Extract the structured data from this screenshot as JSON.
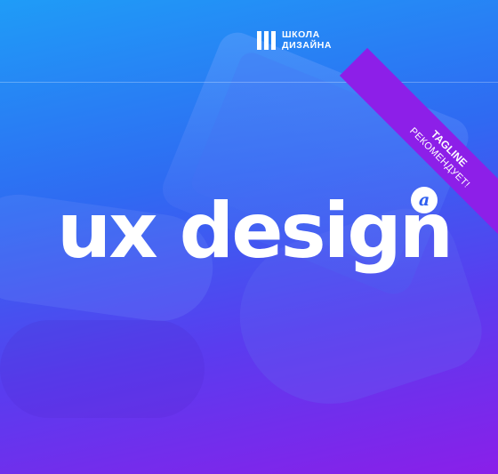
{
  "brand": {
    "line1": "ШКОЛА",
    "line2": "ДИЗАЙНА",
    "mark_icon": "three-bars-icon"
  },
  "ribbon": {
    "title": "TAGLINE",
    "subtitle": "РЕКОМЕНДУЕТ!",
    "color": "#8d1fe8"
  },
  "hero": {
    "title": "ux design",
    "badge": "a",
    "badge_icon": "a-letter-icon"
  },
  "colors": {
    "gradient_top": "#1f9cf7",
    "gradient_mid": "#2f6af2",
    "gradient_bottom": "#8a1fe9"
  }
}
